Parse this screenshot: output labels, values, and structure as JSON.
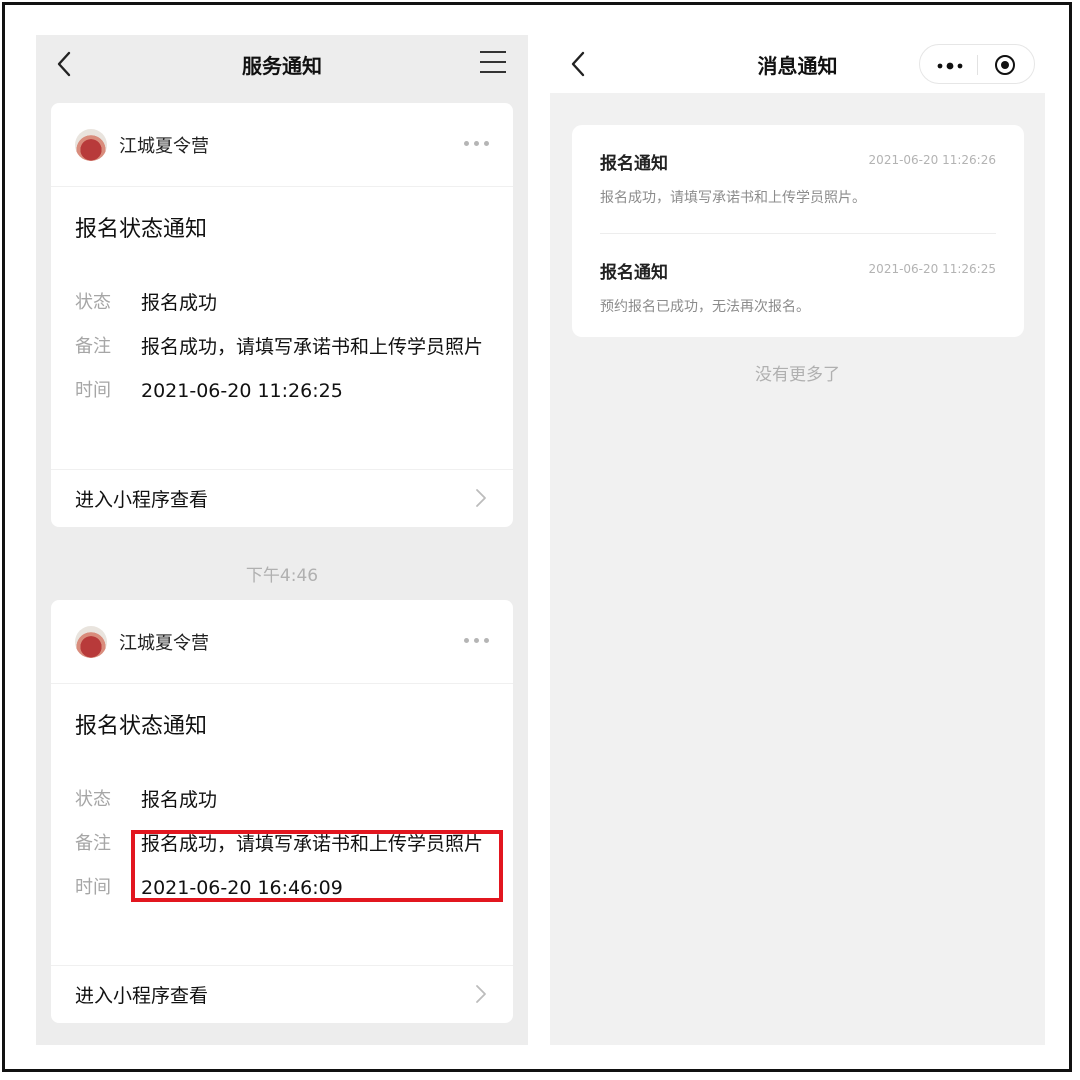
{
  "left": {
    "nav": {
      "title": "服务通知"
    },
    "cards": [
      {
        "app_name": "江城夏令营",
        "notice_title": "报名状态通知",
        "rows": [
          {
            "key": "状态",
            "value": "报名成功"
          },
          {
            "key": "备注",
            "value": "报名成功，请填写承诺书和上传学员照片"
          },
          {
            "key": "时间",
            "value": "2021-06-20 11:26:25"
          }
        ],
        "footer": "进入小程序查看"
      },
      {
        "app_name": "江城夏令营",
        "notice_title": "报名状态通知",
        "rows": [
          {
            "key": "状态",
            "value": "报名成功"
          },
          {
            "key": "备注",
            "value": "报名成功，请填写承诺书和上传学员照片"
          },
          {
            "key": "时间",
            "value": "2021-06-20 16:46:09"
          }
        ],
        "footer": "进入小程序查看"
      }
    ],
    "time_separator": "下午4:46",
    "highlight_color": "#e2161f"
  },
  "right": {
    "nav": {
      "title": "消息通知"
    },
    "messages": [
      {
        "title": "报名通知",
        "time": "2021-06-20 11:26:26",
        "desc": "报名成功，请填写承诺书和上传学员照片。"
      },
      {
        "title": "报名通知",
        "time": "2021-06-20 11:26:25",
        "desc": "预约报名已成功，无法再次报名。"
      }
    ],
    "footer_text": "没有更多了"
  }
}
